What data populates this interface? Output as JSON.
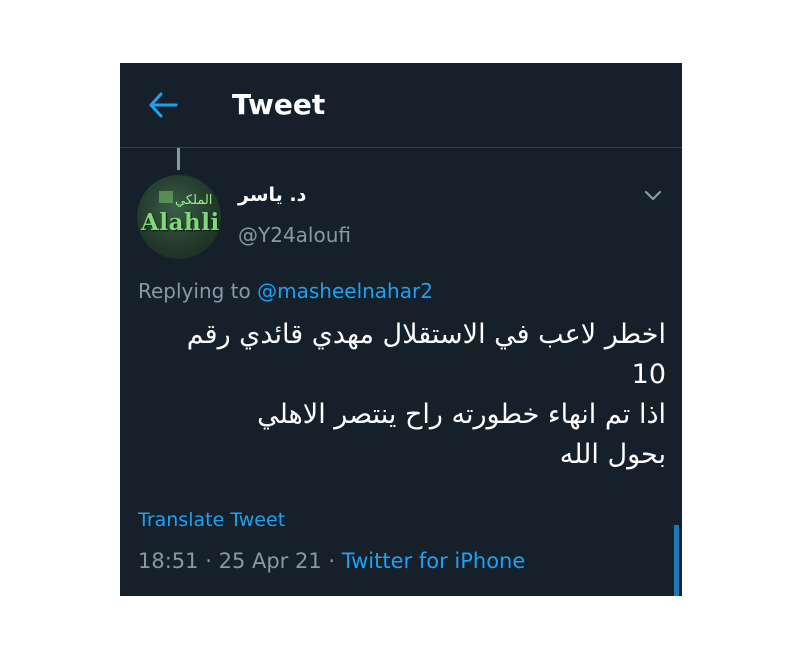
{
  "header": {
    "title": "Tweet",
    "back_icon": "arrow-left-icon"
  },
  "tweet": {
    "author": {
      "display_name": "د. ياسر",
      "username": "@Y24aloufi",
      "avatar_text": "Alahli",
      "avatar_arabic": "الملكي"
    },
    "replying_to_label": "Replying to",
    "replying_to_handle": "@masheelnahar2",
    "text_lines": [
      "اخطر لاعب في الاستقلال مهدي قائدي رقم",
      "10",
      "اذا تم انهاء خطورته راح ينتصر الاهلي",
      "بحول الله"
    ],
    "translate_label": "Translate Tweet",
    "time": "18:51",
    "separator": "·",
    "date": "25 Apr 21",
    "source": "Twitter for iPhone"
  },
  "colors": {
    "background": "#15202b",
    "accent": "#1da1f2",
    "secondary_text": "#8899a6",
    "primary_text": "#ffffff",
    "divider": "#38444d"
  }
}
